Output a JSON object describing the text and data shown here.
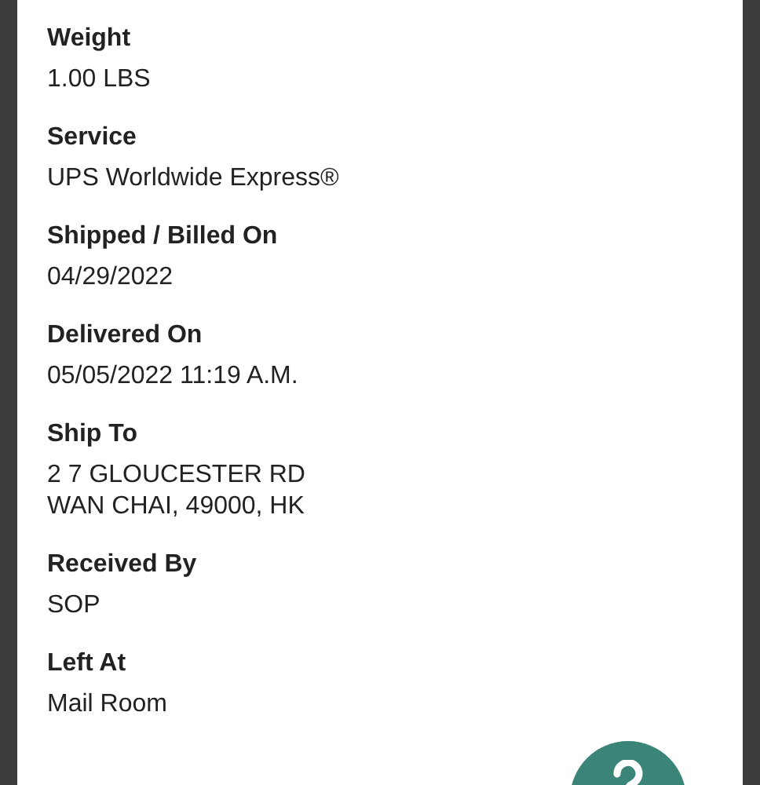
{
  "fields": [
    {
      "label": "Weight",
      "value": [
        "1.00 LBS"
      ]
    },
    {
      "label": "Service",
      "value": [
        "UPS Worldwide Express®"
      ]
    },
    {
      "label": "Shipped / Billed On",
      "value": [
        "04/29/2022"
      ]
    },
    {
      "label": "Delivered On",
      "value": [
        "05/05/2022 11:19 A.M."
      ]
    },
    {
      "label": "Ship To",
      "value": [
        "2 7 GLOUCESTER RD",
        "WAN CHAI, 49000, HK"
      ]
    },
    {
      "label": "Received By",
      "value": [
        "SOP"
      ]
    },
    {
      "label": "Left At",
      "value": [
        "Mail Room"
      ]
    }
  ]
}
